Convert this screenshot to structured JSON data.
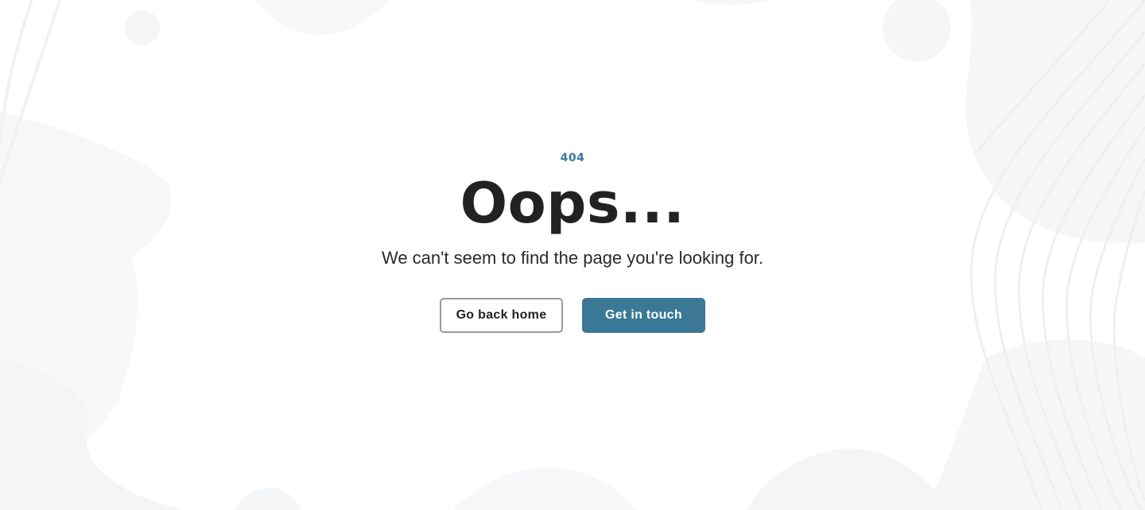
{
  "error": {
    "code": "404",
    "title": "Oops...",
    "message": "We can't seem to find the page you're looking for."
  },
  "actions": {
    "home_label": "Go back home",
    "contact_label": "Get in touch"
  },
  "colors": {
    "accent": "#3a7896",
    "text": "#222222",
    "background": "#ffffff",
    "decoration": "#f5f6f7"
  }
}
